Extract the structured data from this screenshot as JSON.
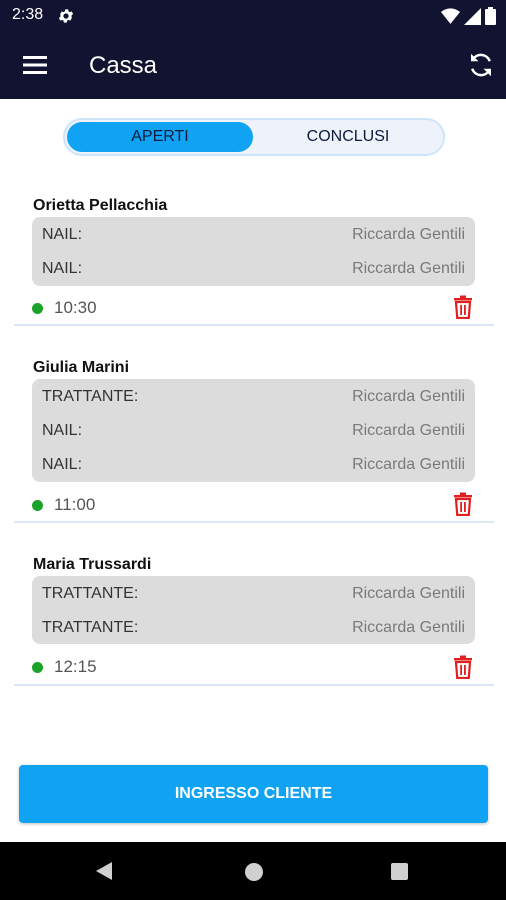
{
  "status_bar": {
    "time": "2:38",
    "icons": [
      "gear-icon",
      "wifi-icon",
      "signal-icon",
      "battery-icon"
    ]
  },
  "app_bar": {
    "title": "Cassa",
    "menu_icon": "hamburger-icon",
    "refresh_icon": "refresh-icon"
  },
  "tabs": {
    "active": "APERTI",
    "inactive": "CONCLUSI"
  },
  "clients": [
    {
      "name": "Orietta Pellacchia",
      "services": [
        {
          "type": "NAIL:",
          "operator": "Riccarda Gentili"
        },
        {
          "type": "NAIL:",
          "operator": "Riccarda Gentili"
        }
      ],
      "time": "10:30"
    },
    {
      "name": "Giulia Marini",
      "services": [
        {
          "type": "TRATTANTE:",
          "operator": "Riccarda Gentili"
        },
        {
          "type": "NAIL:",
          "operator": "Riccarda Gentili"
        },
        {
          "type": "NAIL:",
          "operator": "Riccarda Gentili"
        }
      ],
      "time": "11:00"
    },
    {
      "name": "Maria Trussardi",
      "services": [
        {
          "type": "TRATTANTE:",
          "operator": "Riccarda Gentili"
        },
        {
          "type": "TRATTANTE:",
          "operator": "Riccarda Gentili"
        }
      ],
      "time": "12:15"
    }
  ],
  "cta": {
    "label": "INGRESSO CLIENTE"
  },
  "colors": {
    "header": "#111330",
    "accent": "#10a3f3",
    "status_dot": "#1aa328",
    "trash": "#e0201e"
  }
}
